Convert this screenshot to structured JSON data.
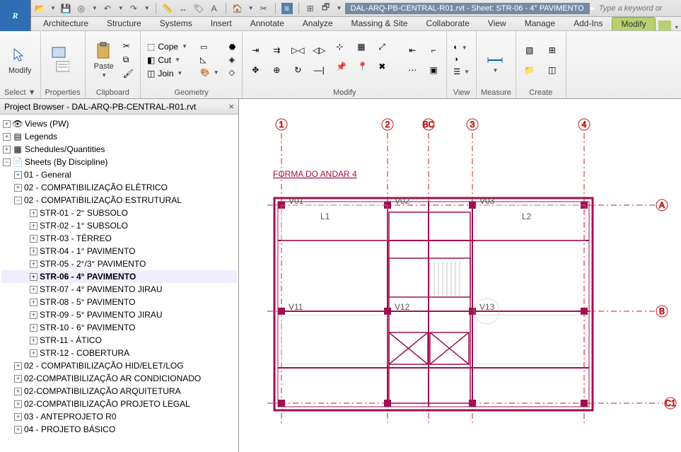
{
  "app": {
    "doc_title": "DAL-ARQ-PB-CENTRAL-R01.rvt - Sheet: STR-06 - 4° PAVIMENTO",
    "search_placeholder": "Type a keyword or"
  },
  "ribbon": {
    "tabs": [
      "Architecture",
      "Structure",
      "Systems",
      "Insert",
      "Annotate",
      "Analyze",
      "Massing & Site",
      "Collaborate",
      "View",
      "Manage",
      "Add-Ins",
      "Modify"
    ],
    "active_tab": "Modify",
    "groups": {
      "select": {
        "label": "Select ▼",
        "modify": "Modify"
      },
      "properties": {
        "label": "Properties"
      },
      "clipboard": {
        "label": "Clipboard",
        "paste": "Paste"
      },
      "geometry": {
        "label": "Geometry",
        "cope": "Cope",
        "cut": "Cut",
        "join": "Join"
      },
      "modify": {
        "label": "Modify"
      },
      "view": {
        "label": "View"
      },
      "measure": {
        "label": "Measure"
      },
      "create": {
        "label": "Create"
      }
    }
  },
  "browser": {
    "title": "Project Browser - DAL-ARQ-PB-CENTRAL-R01.rvt",
    "nodes": {
      "views": "Views (PW)",
      "legends": "Legends",
      "schedules": "Schedules/Quantities",
      "sheets": "Sheets (By Discipline)",
      "g01": "01 - General",
      "g02a": "02 - COMPATIBILIZAÇÃO ELÉTRICO",
      "g02b": "02 - COMPATIBILIZAÇÃO ESTRUTURAL",
      "s01": "STR-01 - 2° SUBSOLO",
      "s02": "STR-02 - 1° SUBSOLO",
      "s03": "STR-03 - TÉRREO",
      "s04": "STR-04 - 1° PAVIMENTO",
      "s05": "STR-05 - 2°/3° PAVIMENTO",
      "s06": "STR-06 - 4° PAVIMENTO",
      "s07": "STR-07 - 4° PAVIMENTO JIRAU",
      "s08": "STR-08 - 5° PAVIMENTO",
      "s09": "STR-09 - 5° PAVIMENTO JIRAU",
      "s10": "STR-10 - 6° PAVIMENTO",
      "s11": "STR-11 - ÁTICO",
      "s12": "STR-12 - COBERTURA",
      "g02c": "02 - COMPATIBILIZAÇÃO HID/ELET/LOG",
      "g02d": "02-COMPATIBILIZAÇÃO AR CONDICIONADO",
      "g02e": "02-COMPATIBILIZAÇÃO ARQUITETURA",
      "g02f": "02-COMPATIBILIZAÇÃO PROJETO LEGAL",
      "g03": "03 - ANTEPROJETO R0",
      "g04": "04 - PROJETO BÁSICO"
    }
  },
  "drawing": {
    "title": "FORMA DO ANDAR 4",
    "grids_top": [
      "1",
      "2",
      "BC",
      "3",
      "4"
    ],
    "grids_right": [
      "A",
      "B",
      "C1"
    ],
    "colors": {
      "grid": "#c02020",
      "struct": "#a01050",
      "arch": "#888888"
    }
  }
}
